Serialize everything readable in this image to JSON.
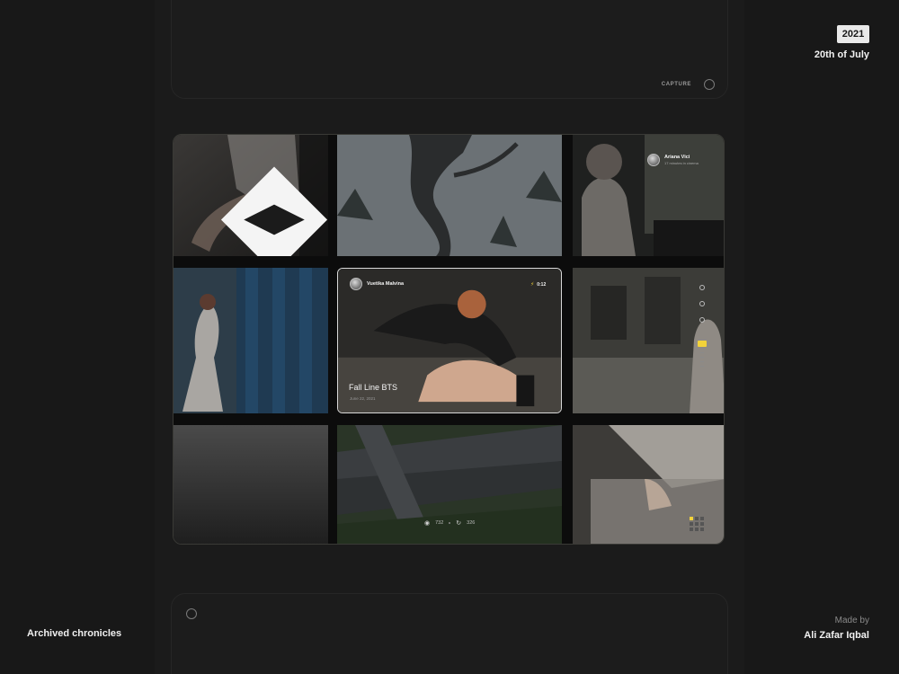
{
  "header": {
    "year": "2021",
    "date": "20th of July"
  },
  "top_card": {
    "capture_label": "CAPTURE"
  },
  "gallery": {
    "top_right_user": {
      "name": "Ariana Vici",
      "subtitle": "17 minutes in cinema"
    },
    "featured": {
      "user_name": "Vuetika Malvina",
      "duration": "0:12",
      "title": "Fall Line BTS",
      "date": "June 22, 2021"
    },
    "stats": {
      "views": "732",
      "replays": "326"
    }
  },
  "footer": {
    "left_title": "Archived chronicles",
    "made_by_label": "Made by",
    "author": "Ali Zafar Iqbal"
  },
  "icons": {
    "logo": "diamond-logo-icon",
    "capture": "circle-record-icon",
    "duration": "bolt-icon",
    "views": "eye-icon",
    "replays": "replay-icon",
    "grid": "grid-icon"
  },
  "colors": {
    "background": "#181818",
    "accent": "#f2d23a",
    "card": "#1c1c1c"
  }
}
